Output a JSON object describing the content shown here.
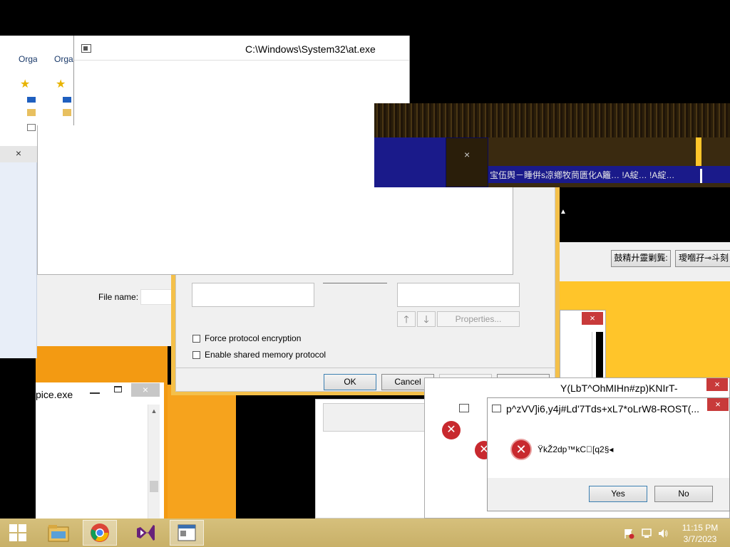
{
  "colors": {
    "orange": "#f39a12",
    "yellow": "#ffc52a",
    "navy": "#1a1a8a",
    "olive": "#3a2a10",
    "taskbar": "#cfb870",
    "error_red": "#c8292e",
    "close_red": "#c83a3a"
  },
  "at_window": {
    "title": "C:\\Windows\\System32\\at.exe"
  },
  "explorer": {
    "organize_label": "Orga",
    "close_label": "×"
  },
  "file_dialog": {
    "file_name_label": "File name:"
  },
  "protocol_dialog": {
    "force_encryption_label": "Force protocol encryption",
    "shared_memory_label": "Enable shared memory protocol",
    "properties_button": "Properties...",
    "ok_button": "OK",
    "cancel_button": "Cancel",
    "apply_button": "Apply",
    "help_button": "Help"
  },
  "service_window": {
    "title": "pice.exe",
    "close_label": "×"
  },
  "garbled_banner": {
    "text": "宝伍舆－睡倂s凉鄕牧茼匮化A籬… !A綻… !A綻…",
    "close_label": "×"
  },
  "cjk_buttons": {
    "button1": "鼓精廾靈剿龔:",
    "button2": "璦嗰孖⊸斗刻"
  },
  "error_dialog_back": {
    "title": "Y(LbT^OhMIHn#zp)KNIrT-",
    "close_label": "×"
  },
  "error_dialog_front": {
    "title": "p^zVV]i6,y4j#Ld'7Tds+xL7*oLrW8-ROST(...",
    "message": "ŸkŽ2dp™kC\u0000[q2§◂",
    "yes_button": "Yes",
    "no_button": "No",
    "close_label": "×"
  },
  "small_dialog": {
    "close_label": "×"
  },
  "taskbar": {
    "apps": [
      "start-button",
      "file-explorer",
      "chrome",
      "visual-studio",
      "active-window"
    ],
    "time": "11:15 PM",
    "date": "3/7/2023"
  }
}
